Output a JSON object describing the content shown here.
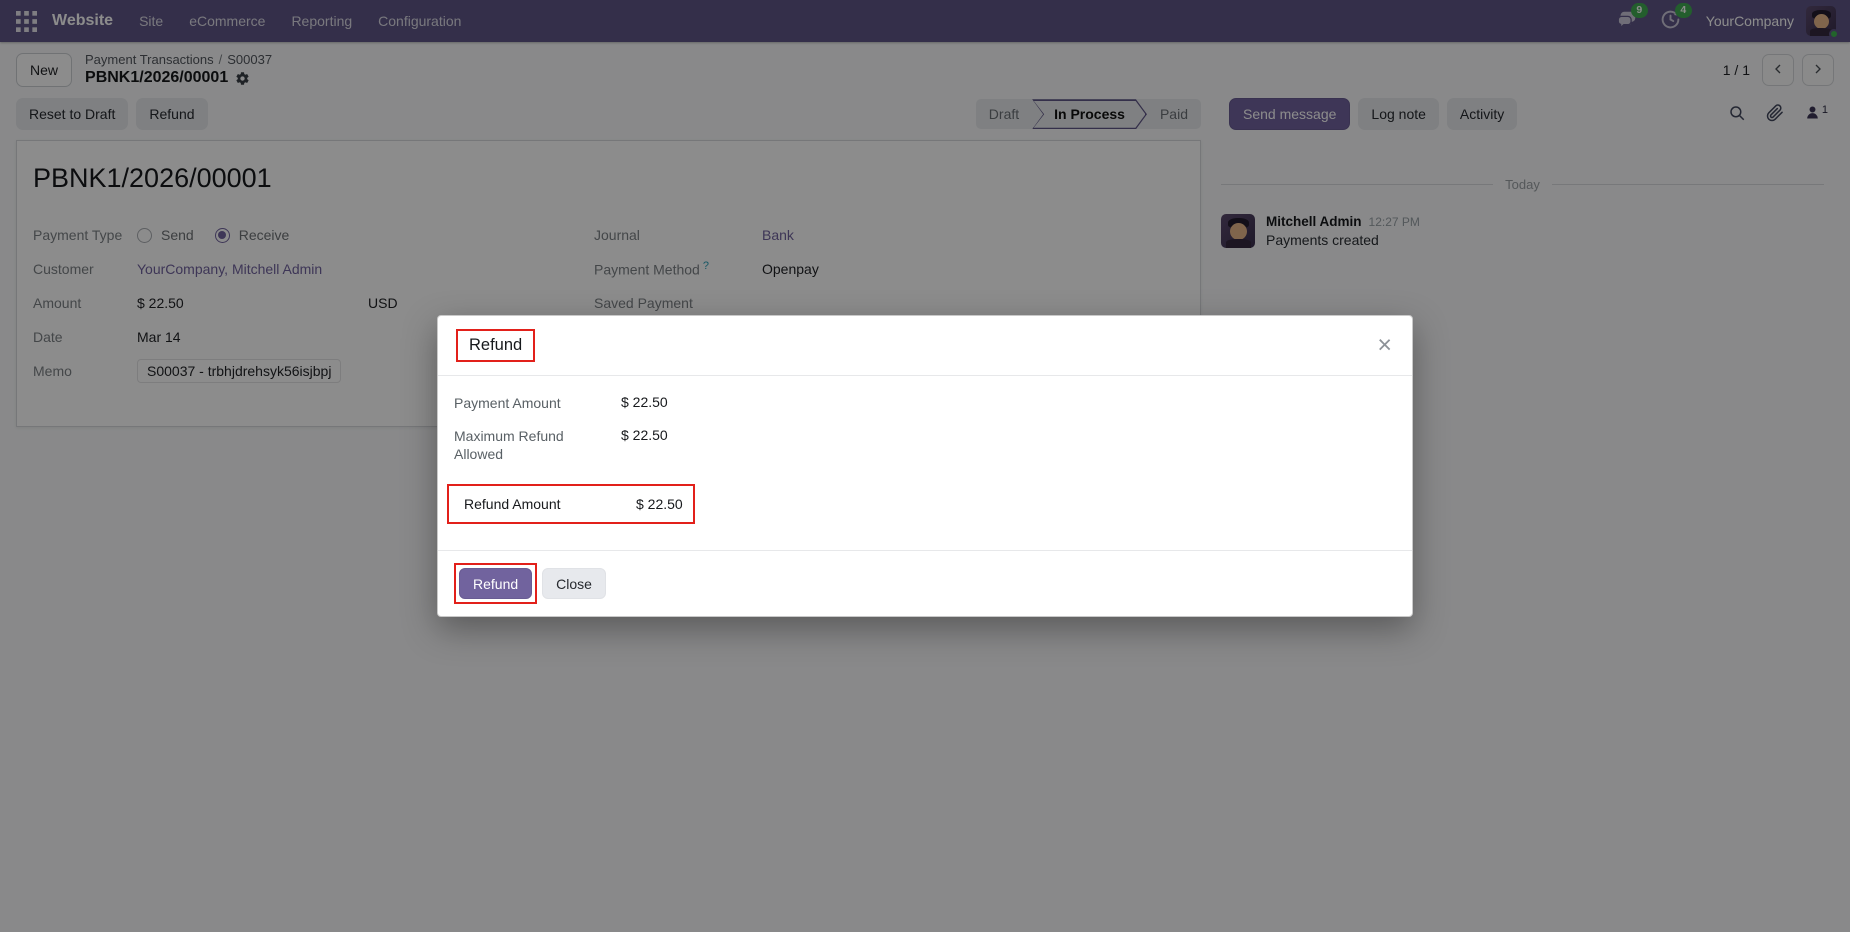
{
  "nav": {
    "app": "Website",
    "menus": [
      "Site",
      "eCommerce",
      "Reporting",
      "Configuration"
    ],
    "company": "YourCompany",
    "message_badge": "9",
    "activity_badge": "4"
  },
  "breadcrumb": {
    "new_label": "New",
    "parent": "Payment Transactions",
    "sep": "/",
    "child": "S00037",
    "current": "PBNK1/2026/00001",
    "pager": "1 / 1"
  },
  "actions": {
    "reset_to_draft": "Reset to Draft",
    "refund": "Refund"
  },
  "statusbar": {
    "steps": [
      "Draft",
      "In Process",
      "Paid"
    ],
    "active": "In Process"
  },
  "chatter": {
    "send_message": "Send message",
    "log_note": "Log note",
    "activity": "Activity",
    "followers_count": "1",
    "date_separator": "Today",
    "message": {
      "author": "Mitchell Admin",
      "time": "12:27 PM",
      "body": "Payments created"
    }
  },
  "sheet": {
    "title": "PBNK1/2026/00001",
    "fields": {
      "payment_type": {
        "label": "Payment Type",
        "options": [
          "Send",
          "Receive"
        ],
        "selected": "Receive"
      },
      "customer": {
        "label": "Customer",
        "value": "YourCompany, Mitchell Admin"
      },
      "amount": {
        "label": "Amount",
        "value": "$ 22.50",
        "currency": "USD"
      },
      "date": {
        "label": "Date",
        "value": "Mar 14"
      },
      "memo": {
        "label": "Memo",
        "value": "S00037 - trbhjdrehsyk56isjbpj"
      },
      "journal": {
        "label": "Journal",
        "value": "Bank"
      },
      "payment_method": {
        "label": "Payment Method",
        "help": "?",
        "value": "Openpay"
      },
      "saved_payment": {
        "label": "Saved Payment",
        "value": ""
      }
    }
  },
  "modal": {
    "title": "Refund",
    "close": "×",
    "rows": [
      {
        "label": "Payment Amount",
        "value": "$ 22.50",
        "highlighted": false
      },
      {
        "label": "Maximum Refund Allowed",
        "value": "$ 22.50",
        "highlighted": false
      },
      {
        "label": "Refund Amount",
        "value": "$ 22.50",
        "highlighted": true
      }
    ],
    "buttons": {
      "refund": "Refund",
      "close": "Close"
    }
  },
  "colors": {
    "primary": "#71639e",
    "navbar": "#5f5787",
    "annotation_red": "#e2201a",
    "badge_green": "#40ab52"
  }
}
